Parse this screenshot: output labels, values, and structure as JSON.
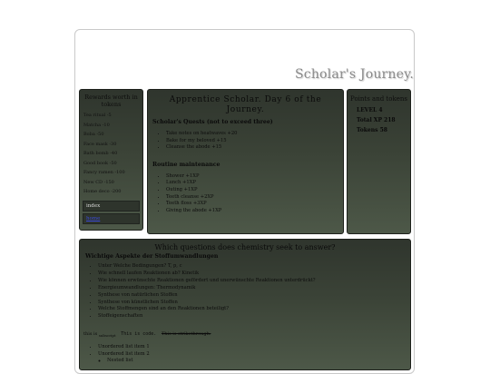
{
  "site": {
    "title": "Scholar's Journey."
  },
  "rewards": {
    "heading": "Rewards worth in tokens",
    "items": [
      "Tea ritual -5",
      "Matcha -10",
      "Boba -50",
      "Face mask -30",
      "Bath bomb -40",
      "Good book -50",
      "Fancy ramen -100",
      "New CD -150",
      "Home deco -200"
    ],
    "nav": {
      "index": "index",
      "link": "home"
    }
  },
  "main": {
    "heading": "Apprentice Scholar. Day 6 of the Journey.",
    "quests_title": "Scholar's Quests (not to exceed three)",
    "quests": [
      "Take notes on heatwaves +20",
      "Bake for my beloved +15",
      "Cleanse the abode +15"
    ],
    "routine_title": "Routine maintenance",
    "routine": [
      "Shower +1XP",
      "Lunch +1XP",
      "Outing +1XP",
      "Teeth cleanse +2XP",
      "Teeth floss +3XP",
      "Giving the abode +1XP"
    ]
  },
  "points": {
    "heading": "Points and tokens",
    "level": "LEVEL 4",
    "xp": "Total XP 218",
    "tokens": "Tokens 58"
  },
  "chem": {
    "heading": "Which questions does chemistry seek to answer?",
    "subheading": "Wichtige Aspekte der Stoffumwandlungen",
    "items": [
      "Unter Welche Bedingungen? T, p, c",
      "Wie schnell laufen Reaktionen ab? Kinetik",
      "Wie können erwünschte Reaktionen gefördert und unerwünschte Reaktionen unterdrückt?",
      "Energieumwandlungen: Thermodynamik",
      "Synthese von natürlichen Stoffen",
      "Synthese von künstlichen Stoffen",
      "Welche Stoffmengen sind an den Reaktionen beteiligt?",
      "Stoffeigenschaften"
    ],
    "mixed": {
      "sub_prefix": "this is ",
      "sub_text": "subscript",
      "code": "This is code.",
      "strike": "This is strikethrough."
    },
    "unordered": [
      "Unordered list item 1",
      "Unordered list item 2"
    ],
    "nested": [
      "Nested list"
    ]
  }
}
